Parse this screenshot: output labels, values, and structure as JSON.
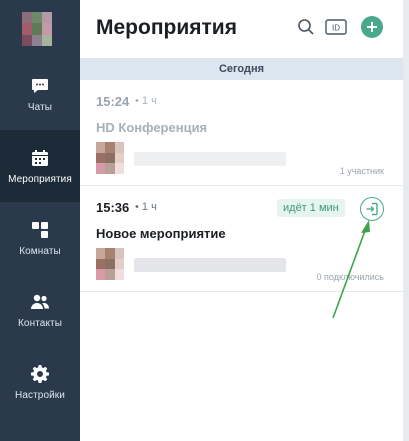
{
  "sidebar": {
    "items": [
      {
        "label": "Чаты",
        "icon": "chat-icon"
      },
      {
        "label": "Мероприятия",
        "icon": "calendar-icon",
        "active": true
      },
      {
        "label": "Комнаты",
        "icon": "rooms-icon"
      },
      {
        "label": "Контакты",
        "icon": "contacts-icon"
      },
      {
        "label": "Настройки",
        "icon": "gear-icon"
      }
    ]
  },
  "header": {
    "title": "Мероприятия",
    "search_icon": "search-icon",
    "id_icon": "id-icon",
    "id_label": "ID",
    "add_icon": "plus-icon"
  },
  "date_separator": "Сегодня",
  "events": [
    {
      "time": "15:24",
      "duration": "• 1 ч",
      "title": "HD Конференция",
      "participants": "1 участник"
    },
    {
      "time": "15:36",
      "duration": "• 1 ч",
      "title": "Новое мероприятие",
      "status": "идёт 1 мин",
      "participants": "0 подключились",
      "join_icon": "enter-icon"
    }
  ],
  "colors": {
    "sidebar": "#2a3a4c",
    "sidebar_active": "#1d2a38",
    "accent": "#4aa98c",
    "date_bar": "#dbe6f0",
    "annotation_arrow": "#3fa34d"
  }
}
